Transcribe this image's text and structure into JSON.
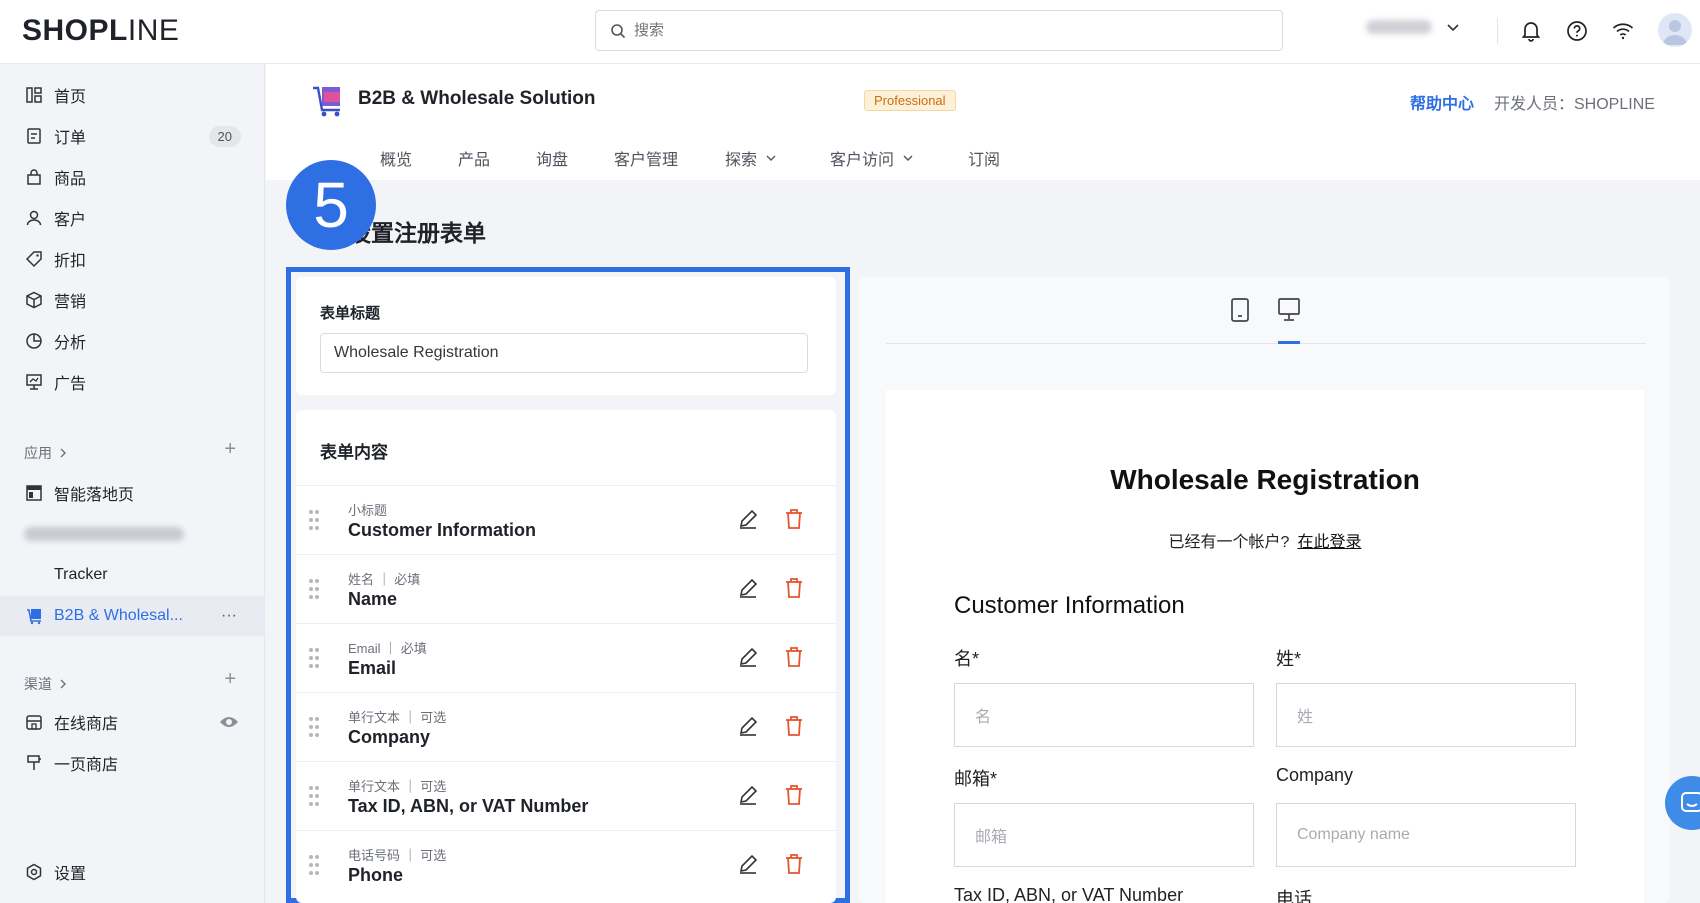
{
  "brand": {
    "logo_main": "SHOP",
    "logo_mid": "L",
    "logo_end": "INE"
  },
  "search": {
    "placeholder": "搜索"
  },
  "sidebar": {
    "items": [
      {
        "label": "首页",
        "icon": "dashboard-icon"
      },
      {
        "label": "订单",
        "icon": "order-icon",
        "badge": "20"
      },
      {
        "label": "商品",
        "icon": "bag-icon"
      },
      {
        "label": "客户",
        "icon": "user-icon"
      },
      {
        "label": "折扣",
        "icon": "tag-icon"
      },
      {
        "label": "营销",
        "icon": "cube-icon"
      },
      {
        "label": "分析",
        "icon": "pie-icon"
      },
      {
        "label": "广告",
        "icon": "ad-icon"
      }
    ],
    "apps_header": "应用",
    "apps": [
      {
        "label": "智能落地页",
        "icon": "layout-icon"
      },
      {
        "label": "Tracker"
      },
      {
        "label": "B2B & Wholesal...",
        "icon": "b2b-icon",
        "more": "···"
      }
    ],
    "channels_header": "渠道",
    "channels": [
      {
        "label": "在线商店",
        "icon": "store-icon"
      },
      {
        "label": "一页商店",
        "icon": "onepage-icon"
      }
    ],
    "settings": "设置"
  },
  "app": {
    "title": "B2B & Wholesale Solution",
    "plan_badge": "Professional",
    "help_link": "帮助中心",
    "developer": "开发人员：SHOPLINE",
    "tabs": [
      "概览",
      "产品",
      "询盘",
      "客户管理",
      "探索",
      "客户访问",
      "订阅"
    ]
  },
  "step_number": "5",
  "page_title": "设置注册表单",
  "form_title_card": {
    "label": "表单标题",
    "value": "Wholesale Registration"
  },
  "form_content": {
    "label": "表单内容",
    "fields": [
      {
        "meta": "小标题",
        "name": "Customer Information"
      },
      {
        "meta": "姓名 ｜ 必填",
        "name": "Name"
      },
      {
        "meta": "Email ｜ 必填",
        "name": "Email"
      },
      {
        "meta": "单行文本 ｜ 可选",
        "name": "Company"
      },
      {
        "meta": "单行文本 ｜ 可选",
        "name": "Tax ID, ABN, or VAT Number"
      },
      {
        "meta": "电话号码 ｜ 可选",
        "name": "Phone"
      }
    ]
  },
  "preview": {
    "title": "Wholesale Registration",
    "login_prompt": "已经有一个帐户?",
    "login_link": "在此登录",
    "section": "Customer Information",
    "first_name_label": "名*",
    "first_name_ph": "名",
    "last_name_label": "姓*",
    "last_name_ph": "姓",
    "email_label": "邮箱*",
    "email_ph": "邮箱",
    "company_label": "Company",
    "company_ph": "Company name",
    "tax_label": "Tax ID, ABN, or VAT Number",
    "phone_label": "电话"
  },
  "colors": {
    "accent": "#2f6fe4",
    "danger": "#e8542f",
    "badge_bg": "#fdf0d8"
  }
}
